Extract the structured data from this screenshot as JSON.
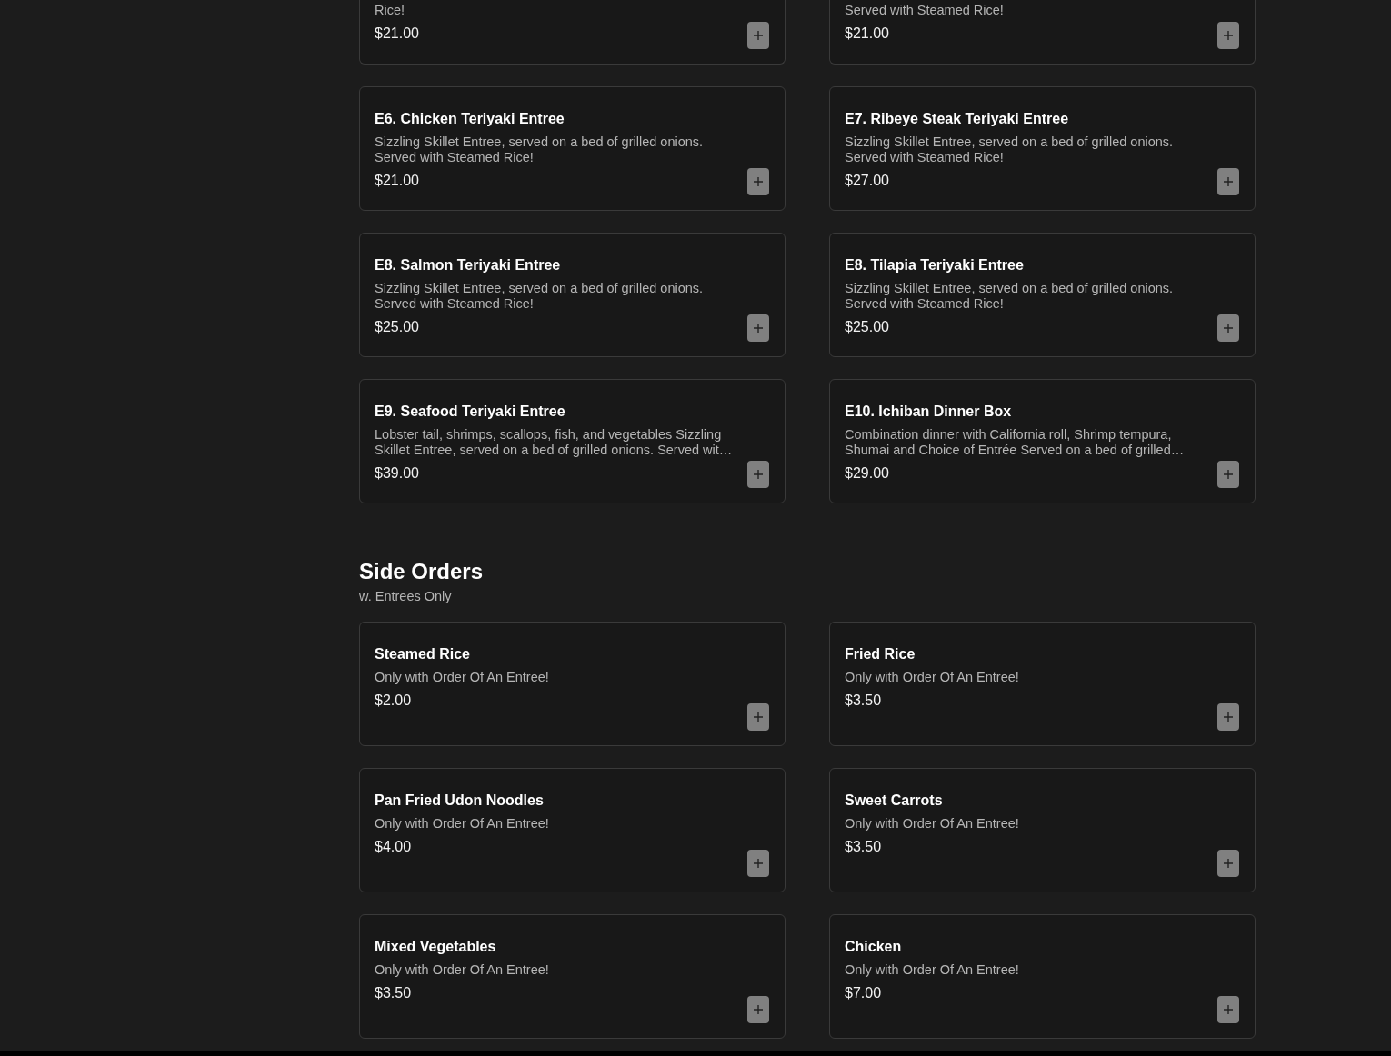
{
  "sections": [
    {
      "items": [
        {
          "kind": "cut",
          "description": "Rice!",
          "price": "$21.00"
        },
        {
          "kind": "cut",
          "description": "Served with Steamed Rice!",
          "price": "$21.00"
        },
        {
          "kind": "full",
          "name": "E6. Chicken Teriyaki Entree",
          "description": "Sizzling Skillet Entree, served on a bed of grilled onions. Served with Steamed Rice!",
          "price": "$21.00"
        },
        {
          "kind": "full",
          "name": "E7. Ribeye Steak Teriyaki Entree",
          "description": "Sizzling Skillet Entree, served on a bed of grilled onions. Served with Steamed Rice!",
          "price": "$27.00"
        },
        {
          "kind": "full",
          "name": "E8. Salmon Teriyaki Entree",
          "description": "Sizzling Skillet Entree, served on a bed of grilled onions. Served with Steamed Rice!",
          "price": "$25.00"
        },
        {
          "kind": "full",
          "name": "E8. Tilapia Teriyaki Entree",
          "description": "Sizzling Skillet Entree, served on a bed of grilled onions. Served with Steamed Rice!",
          "price": "$25.00"
        },
        {
          "kind": "full",
          "name": "E9. Seafood Teriyaki Entree",
          "description": "Lobster tail, shrimps, scallops, fish, and vegetables Sizzling Skillet Entree, served on a bed of grilled onions. Served wit…",
          "price": "$39.00"
        },
        {
          "kind": "full",
          "name": "E10. Ichiban Dinner Box",
          "description": "Combination dinner with California roll, Shrimp tempura, Shumai and Choice of Entrée Served on a bed of grilled…",
          "price": "$29.00"
        }
      ]
    },
    {
      "title": "Side Orders",
      "subtitle": "w. Entrees Only",
      "items": [
        {
          "kind": "full",
          "name": "Steamed Rice",
          "description": "Only with Order Of An Entree!",
          "price": "$2.00"
        },
        {
          "kind": "full",
          "name": "Fried Rice",
          "description": "Only with Order Of An Entree!",
          "price": "$3.50"
        },
        {
          "kind": "full",
          "name": "Pan Fried Udon Noodles",
          "description": "Only with Order Of An Entree!",
          "price": "$4.00"
        },
        {
          "kind": "full",
          "name": "Sweet Carrots",
          "description": "Only with Order Of An Entree!",
          "price": "$3.50"
        },
        {
          "kind": "full",
          "name": "Mixed Vegetables",
          "description": "Only with Order Of An Entree!",
          "price": "$3.50"
        },
        {
          "kind": "full",
          "name": "Chicken",
          "description": "Only with Order Of An Entree!",
          "price": "$7.00"
        }
      ]
    }
  ]
}
